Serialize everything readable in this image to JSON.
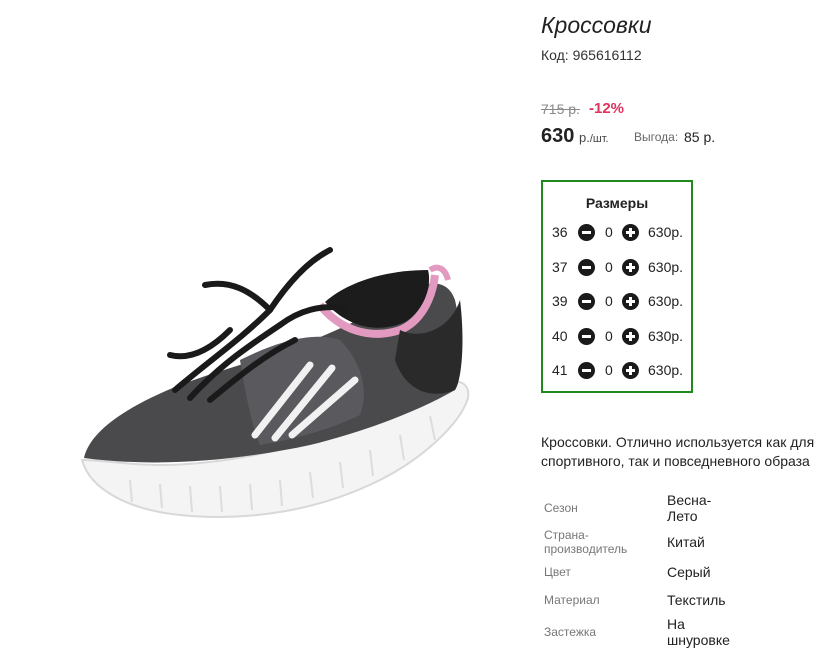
{
  "product": {
    "title": "Кроссовки",
    "code": "Код: 965616112",
    "old_price": "715 р.",
    "discount": "-12%",
    "price": "630",
    "unit_currency": "р.",
    "unit_per": "/шт.",
    "savings_label": "Выгода:",
    "savings_value": "85 р.",
    "image_icon": "sneaker-image",
    "colors": {
      "border_accent": "#1e8a1e",
      "discount": "#e0325c"
    }
  },
  "sizes": {
    "title": "Размеры",
    "rows": [
      {
        "size": "36",
        "qty": "0",
        "price": "630р."
      },
      {
        "size": "37",
        "qty": "0",
        "price": "630р."
      },
      {
        "size": "39",
        "qty": "0",
        "price": "630р."
      },
      {
        "size": "40",
        "qty": "0",
        "price": "630р."
      },
      {
        "size": "41",
        "qty": "0",
        "price": "630р."
      }
    ]
  },
  "description": "Кроссовки. Отлично используется как для\nспортивного, так и повседневного образа",
  "specs": [
    {
      "label": "Сезон",
      "value": "Весна-\nЛето"
    },
    {
      "label": "Страна-\nпроизводитель",
      "value": "Китай"
    },
    {
      "label": "Цвет",
      "value": "Серый"
    },
    {
      "label": "Материал",
      "value": "Текстиль"
    },
    {
      "label": "Застежка",
      "value": "На\nшнуровке"
    }
  ]
}
